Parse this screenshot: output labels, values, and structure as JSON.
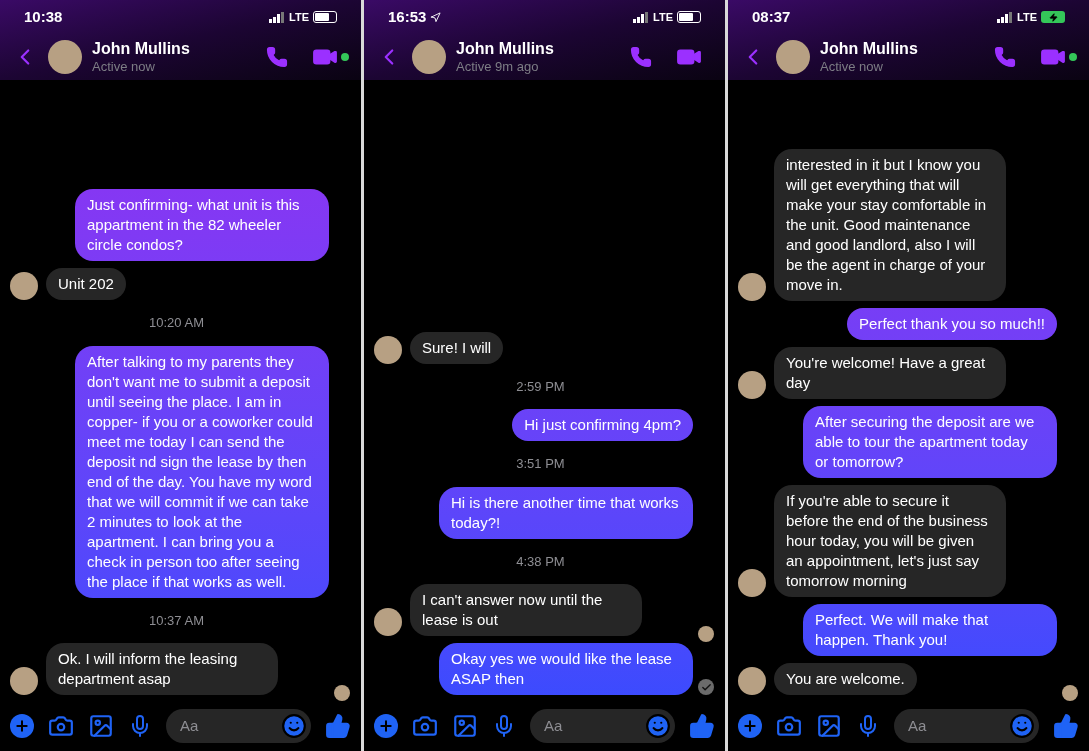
{
  "screens": [
    {
      "status": {
        "time": "10:38",
        "network": "LTE",
        "location": false,
        "charging": false
      },
      "contact": {
        "name": "John Mullins",
        "status": "Active now",
        "online": true
      },
      "messages": [
        {
          "kind": "sent",
          "text": "Just confirming- what unit is this appartment in the 82 wheeler circle condos?"
        },
        {
          "kind": "received",
          "text": "Unit 202",
          "avatar": true,
          "seen": false
        },
        {
          "kind": "time",
          "text": "10:20 AM"
        },
        {
          "kind": "sent",
          "text": "After talking to my parents they don't want me to submit a deposit until seeing the place. I am in copper- if you or a coworker could meet me today I can send the deposit nd sign the lease by then end of the day. You have my word that we will commit if we can take 2 minutes to look at the apartment. I can bring you a check in person too after seeing the place if that works as well."
        },
        {
          "kind": "time",
          "text": "10:37 AM"
        },
        {
          "kind": "received",
          "text": "Ok. I will inform the leasing department asap",
          "avatar": true,
          "seen": true
        }
      ],
      "composer": {
        "placeholder": "Aa"
      }
    },
    {
      "status": {
        "time": "16:53",
        "network": "LTE",
        "location": true,
        "charging": false
      },
      "contact": {
        "name": "John Mullins",
        "status": "Active 9m ago",
        "online": false
      },
      "messages": [
        {
          "kind": "received",
          "text": "Sure! I will",
          "avatar": true,
          "seen": false
        },
        {
          "kind": "time",
          "text": "2:59 PM"
        },
        {
          "kind": "sent",
          "text": "Hi just confirming 4pm?"
        },
        {
          "kind": "time",
          "text": "3:51 PM"
        },
        {
          "kind": "sent",
          "text": "Hi is there another time that works today?!"
        },
        {
          "kind": "time",
          "text": "4:38 PM"
        },
        {
          "kind": "received",
          "text": "I can't answer now until the lease is out",
          "avatar": true,
          "seen": true
        },
        {
          "kind": "sent",
          "text": "Okay yes we would like the lease ASAP then",
          "delivered": true
        }
      ],
      "composer": {
        "placeholder": "Aa"
      }
    },
    {
      "status": {
        "time": "08:37",
        "network": "LTE",
        "location": false,
        "charging": true
      },
      "contact": {
        "name": "John Mullins",
        "status": "Active now",
        "online": true
      },
      "messages": [
        {
          "kind": "received",
          "text": "interested in it but I know you will get everything that will make your stay comfortable in the unit. Good maintenance and good landlord, also I will be the agent in charge of your move in.",
          "avatar": true,
          "seen": false
        },
        {
          "kind": "sent",
          "text": "Perfect thank you so much!!"
        },
        {
          "kind": "received",
          "text": "You're welcome! Have a great day",
          "avatar": true,
          "seen": false
        },
        {
          "kind": "sent",
          "text": "After securing the deposit are we able to tour the apartment today or tomorrow?"
        },
        {
          "kind": "received",
          "text": "If you're able to secure it before the end of the business hour today, you will be given an appointment, let's just say tomorrow morning",
          "avatar": true,
          "seen": false
        },
        {
          "kind": "sent",
          "text": "Perfect. We will make that happen. Thank you!"
        },
        {
          "kind": "received",
          "text": "You are welcome.",
          "avatar": true,
          "seen": true
        }
      ],
      "composer": {
        "placeholder": "Aa"
      }
    }
  ]
}
